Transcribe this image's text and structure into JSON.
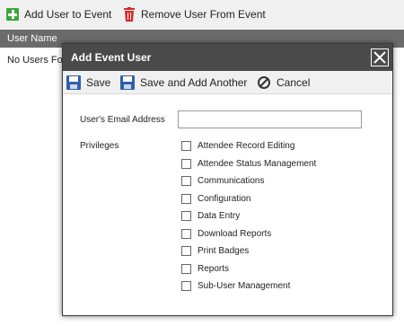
{
  "toolbar": {
    "add_label": "Add User to Event",
    "remove_label": "Remove User From Event"
  },
  "grid": {
    "column_user_name": "User Name",
    "empty_text": "No Users Found"
  },
  "dialog": {
    "title": "Add Event User",
    "save_label": "Save",
    "save_add_label": "Save and Add Another",
    "cancel_label": "Cancel",
    "email_label": "User's Email Address",
    "email_value": "",
    "privileges_label": "Privileges",
    "privileges": [
      "Attendee Record Editing",
      "Attendee Status Management",
      "Communications",
      "Configuration",
      "Data Entry",
      "Download Reports",
      "Print Badges",
      "Reports",
      "Sub-User Management"
    ]
  },
  "colors": {
    "add_green": "#39a839",
    "remove_red": "#d42a2a",
    "save_blue": "#2f5fa8",
    "header_gray": "#6b6b6b",
    "dialog_title": "#4a4a4a"
  }
}
